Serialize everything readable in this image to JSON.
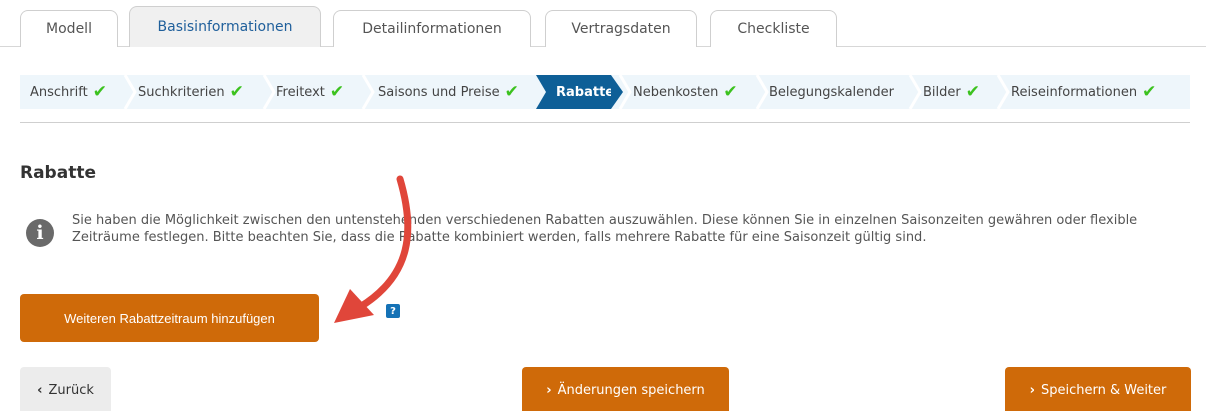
{
  "tabs": [
    {
      "label": "Modell"
    },
    {
      "label": "Basisinformationen"
    },
    {
      "label": "Detailinformationen"
    },
    {
      "label": "Vertragsdaten"
    },
    {
      "label": "Checkliste"
    }
  ],
  "steps": [
    {
      "label": "Anschrift",
      "done": true
    },
    {
      "label": "Suchkriterien",
      "done": true
    },
    {
      "label": "Freitext",
      "done": true
    },
    {
      "label": "Saisons und Preise",
      "done": true
    },
    {
      "label": "Rabatte",
      "active": true
    },
    {
      "label": "Nebenkosten",
      "done": true
    },
    {
      "label": "Belegungskalender",
      "done": false
    },
    {
      "label": "Bilder",
      "done": true
    },
    {
      "label": "Reiseinformationen",
      "done": true
    }
  ],
  "section": {
    "title": "Rabatte",
    "info_icon": "info-icon",
    "info_text": "Sie haben die Möglichkeit zwischen den untenstehenden verschiedenen Rabatten auszuwählen. Diese können Sie in einzelnen Saisonzeiten gewähren oder flexible Zeiträume festlegen. Bitte beachten Sie, dass die Rabatte kombiniert werden, falls mehrere Rabatte für eine Saisonzeit gültig sind."
  },
  "actions": {
    "add_label": "Weiteren Rabattzeitraum hinzufügen",
    "help_label": "?",
    "back_label": "Zurück",
    "save_label": "Änderungen speichern",
    "next_label": "Speichern & Weiter"
  },
  "colors": {
    "accent_orange": "#cf6a09",
    "active_step": "#0e5f97",
    "check_green": "#3cc21f",
    "annotation_arrow": "#e0463a"
  }
}
